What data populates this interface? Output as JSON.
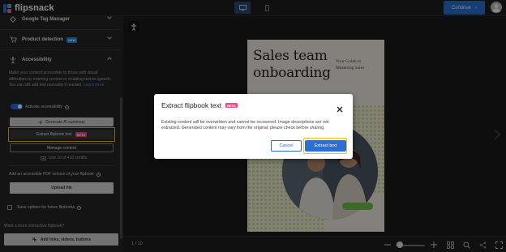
{
  "app": {
    "logo_text": "flipsnack"
  },
  "topbar": {
    "continue_label": "Continue",
    "continue_chevron": "›"
  },
  "sidebar": {
    "rows": [
      {
        "label": "Google Tag Manager",
        "icon": "diamond-icon"
      },
      {
        "label": "Product detection",
        "badge": "NEW",
        "icon": "cart-icon"
      },
      {
        "label": "Accessibility",
        "icon": "accessibility-icon"
      }
    ],
    "accessibility": {
      "description": "Make your content accessible to those with visual difficulties by entering content or enabling text-to-speech. You can still add text manually if needed.",
      "learn_more": "Learn more",
      "generate_summary": "Generate AI summary",
      "activate_label": "Activate accessibility",
      "extract_label": "Extract flipbook text",
      "extract_badge": "BETA",
      "manage_label": "Manage content",
      "credits_label": "Use 10 of 410 credits",
      "pdf_label": "Add an accessible PDF version of your flipbook",
      "upload_label": "Upload file",
      "save_options_label": "Save options for future flipbooks"
    },
    "interactive_prompt": "Want a more interactive flipbook?",
    "add_links_label": "Add links, videos, buttons"
  },
  "flipbook": {
    "title_line1": "Sales team",
    "title_line2": "onboarding",
    "subtitle_line1": "Your Guide to",
    "subtitle_line2": "Mastering Sales",
    "page_count": "1 / 10"
  },
  "modal": {
    "title": "Extract flipbook text",
    "badge": "BETA",
    "body": "Existing content will be overwritten and cannot be recovered. Image descriptions are not extracted. Generated content may vary from the original; please check before sharing.",
    "cancel_label": "Cancel",
    "confirm_label": "Extract text"
  },
  "colors": {
    "accent": "#2b6fd6",
    "highlight": "#f2c21b",
    "beta": "#ec4d8b",
    "dots": "#c6e07a"
  }
}
